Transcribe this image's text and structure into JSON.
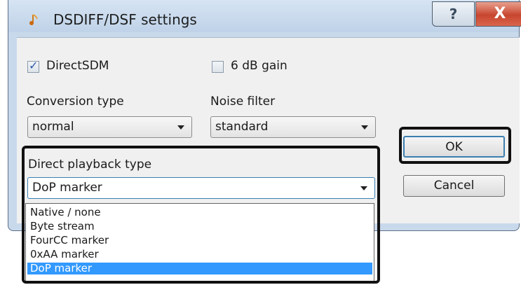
{
  "window": {
    "title": "DSDIFF/DSF settings",
    "help_label": "?",
    "close_label": "X"
  },
  "options": {
    "direct_sdm": {
      "label": "DirectSDM",
      "checked": true,
      "check_mark": "✓"
    },
    "gain_6db": {
      "label": "6 dB gain",
      "checked": false
    }
  },
  "conversion_type": {
    "label": "Conversion type",
    "value": "normal"
  },
  "noise_filter": {
    "label": "Noise filter",
    "value": "standard"
  },
  "direct_playback": {
    "label": "Direct playback type",
    "value": "DoP marker",
    "options": [
      "Native / none",
      "Byte stream",
      "FourCC marker",
      "0xAA marker",
      "DoP marker"
    ],
    "selected_index": 4
  },
  "buttons": {
    "ok": "OK",
    "cancel": "Cancel"
  },
  "colors": {
    "selection": "#3399ff",
    "focus_border": "#3c7fb1",
    "highlight_box": "#111111"
  }
}
